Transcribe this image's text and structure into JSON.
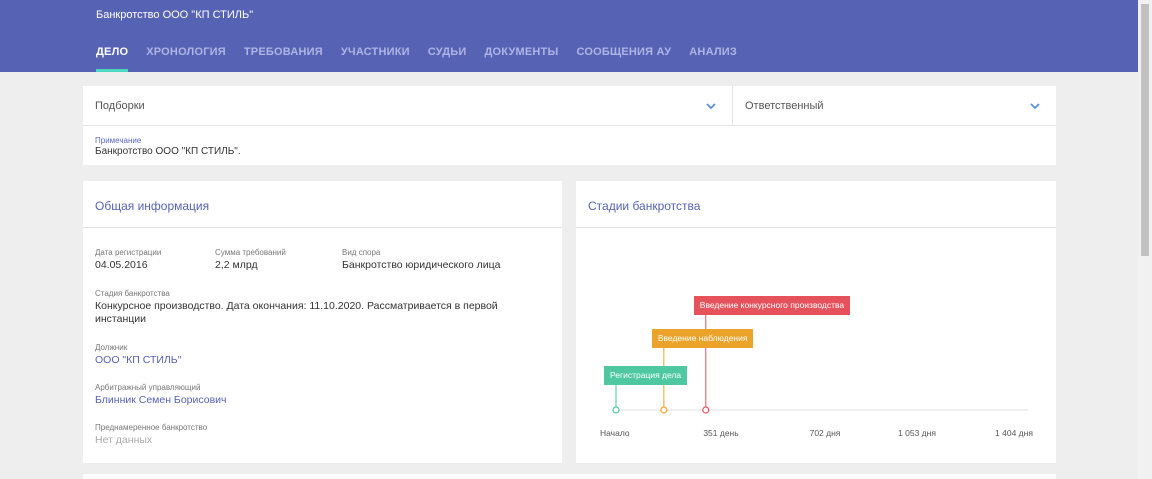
{
  "header": {
    "case_title": "Банкротство ООО \"КП СТИЛЬ\"",
    "tabs": [
      {
        "label": "ДЕЛО",
        "active": true
      },
      {
        "label": "ХРОНОЛОГИЯ"
      },
      {
        "label": "ТРЕБОВАНИЯ"
      },
      {
        "label": "УЧАСТНИКИ"
      },
      {
        "label": "СУДЬИ"
      },
      {
        "label": "ДОКУМЕНТЫ"
      },
      {
        "label": "СООБЩЕНИЯ АУ"
      },
      {
        "label": "АНАЛИЗ"
      }
    ]
  },
  "filters": {
    "collections_label": "Подборки",
    "responsible_label": "Ответственный"
  },
  "note": {
    "label": "Примечание",
    "text": "Банкротство ООО \"КП СТИЛЬ\"."
  },
  "general_info": {
    "title": "Общая информация",
    "registration_date_label": "Дата регистрации",
    "registration_date": "04.05.2016",
    "claims_sum_label": "Сумма требований",
    "claims_sum": "2,2 млрд",
    "dispute_type_label": "Вид спора",
    "dispute_type": "Банкротство юридического лица",
    "stage_label": "Стадия банкротства",
    "stage_line1": "Конкурсное производство. Дата окончания: 11.10.2020. Рассматривается в первой",
    "stage_line2": "инстанции",
    "debtor_label": "Должник",
    "debtor": "ООО \"КП СТИЛЬ\"",
    "manager_label": "Арбитражный управляющий",
    "manager": "Блинник Семен Борисович",
    "deliberate_label": "Преднамеренное банкротство",
    "deliberate": "Нет данных"
  },
  "stages": {
    "title": "Стадии банкротства",
    "colors": {
      "registration": "#4dc8a0",
      "observation": "#eba32a",
      "competition": "#e5525c",
      "axis": "#e0e0e0"
    },
    "events": [
      {
        "label": "Регистрация дела",
        "day": 0,
        "color": "#4dc8a0"
      },
      {
        "label": "Введение наблюдения",
        "day": 163,
        "color": "#eba32a"
      },
      {
        "label": "Введение конкурсного производства",
        "day": 306,
        "color": "#e5525c"
      }
    ],
    "axis_start_label": "Начало",
    "axis_ticks": [
      {
        "value": 351,
        "label": "351 день"
      },
      {
        "value": 702,
        "label": "702 дня"
      },
      {
        "value": 1053,
        "label": "1 053 дня"
      },
      {
        "value": 1404,
        "label": "1 404 дня"
      }
    ],
    "axis_max": 1404
  }
}
